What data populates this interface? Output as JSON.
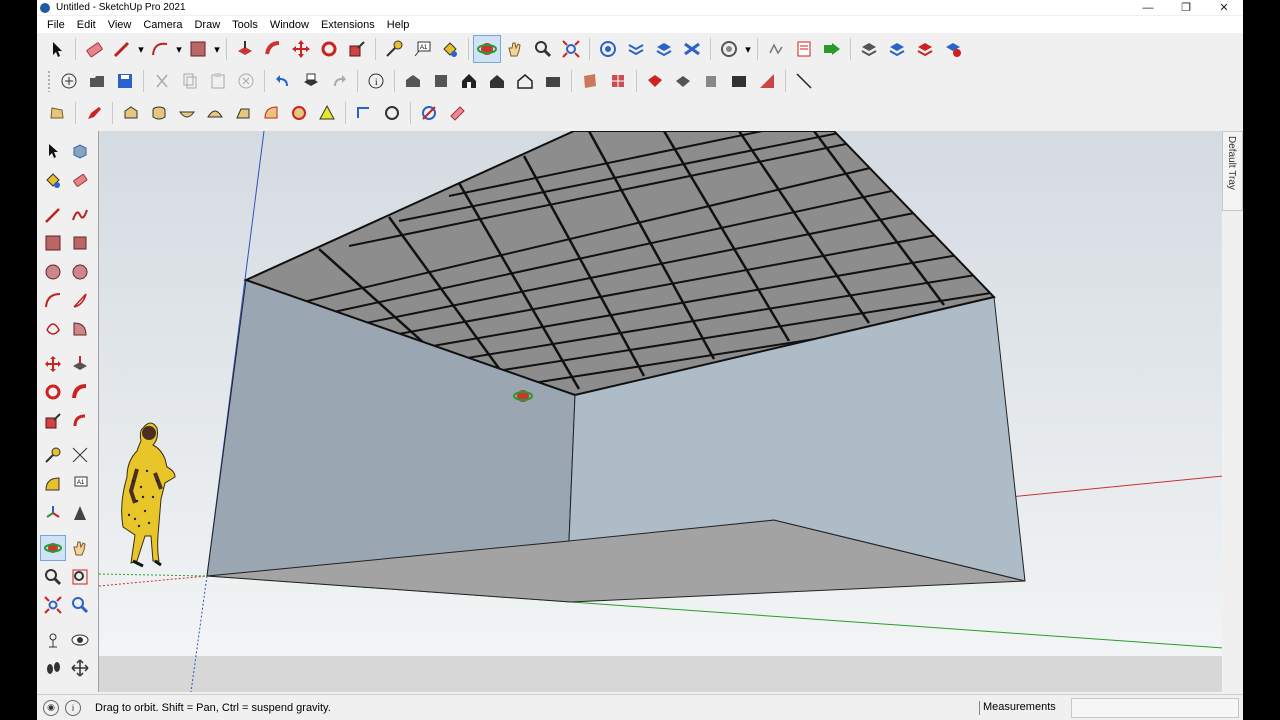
{
  "window": {
    "title": "Untitled - SketchUp Pro 2021",
    "controls": [
      "minimize",
      "restore",
      "close"
    ]
  },
  "menu": [
    "File",
    "Edit",
    "View",
    "Camera",
    "Draw",
    "Tools",
    "Window",
    "Extensions",
    "Help"
  ],
  "toolbar_row1": [
    "select-icon",
    "eraser-icon",
    "pencil-line-icon",
    "arc-icon",
    "rectangle-icon",
    "push-pull-icon",
    "follow-me-icon",
    "move-icon",
    "rotate-icon",
    "scale-icon",
    "tape-measure-icon",
    "text-icon",
    "paint-bucket-icon",
    "orbit-icon",
    "pan-icon",
    "zoom-icon",
    "zoom-extents-icon",
    "sandbox-icon",
    "solid-tools-icon",
    "components-icon",
    "styles-icon",
    "search-icon",
    "warehouse-icon",
    "layout-icon",
    "report-icon",
    "extension-icon"
  ],
  "toolbar_row2": [
    "new-icon",
    "open-icon",
    "save-icon",
    "cut-icon",
    "copy-icon",
    "paste-icon",
    "delete-icon",
    "undo-icon",
    "print-icon",
    "redo-icon",
    "model-info-icon",
    "iso-view-icon",
    "top-view-icon",
    "front-view-icon",
    "right-view-icon",
    "back-view-icon",
    "left-view-icon",
    "xray-icon",
    "wireframe-icon",
    "hidden-line-icon",
    "shaded-icon",
    "textured-icon",
    "monochrome-icon",
    "section-plane-icon"
  ],
  "toolbar_row3": [
    "warehouse-pin-icon",
    "eraser-red-icon",
    "cube-icon",
    "cylinder-icon",
    "bowl-icon",
    "dome-icon",
    "prism-icon",
    "arc-cube-icon",
    "torus-icon",
    "cone-icon",
    "extrude-icon",
    "sphere-icon",
    "gear-icon",
    "paint-icon"
  ],
  "palette_icons": [
    "select-icon",
    "component-icon",
    "paint-bucket-icon",
    "eraser-icon",
    "line-icon",
    "freehand-icon",
    "rectangle-icon",
    "rotated-rect-icon",
    "circle-icon",
    "polygon-icon",
    "arc-icon",
    "two-point-arc-icon",
    "three-point-arc-icon",
    "pie-icon",
    "move-icon",
    "push-pull-icon",
    "rotate-icon",
    "follow-me-icon",
    "scale-icon",
    "offset-icon",
    "tape-measure-icon",
    "dimension-icon",
    "protractor-icon",
    "text-icon",
    "axes-icon",
    "3d-text-icon",
    "orbit-icon",
    "pan-icon",
    "zoom-icon",
    "zoom-window-icon",
    "zoom-extents-icon",
    "previous-view-icon",
    "position-camera-icon",
    "look-around-icon",
    "walk-icon",
    "section-icon"
  ],
  "tray": {
    "label": "Default Tray"
  },
  "status": {
    "hint": "Drag to orbit. Shift = Pan, Ctrl = suspend gravity.",
    "measurements_label": "Measurements",
    "measurements_value": ""
  },
  "colors": {
    "active_tool_bg": "#cfe3f7",
    "axis_red": "#c83232",
    "axis_green": "#2c9b2c",
    "axis_blue": "#3050c8",
    "wall_left": "#9aa8b4",
    "wall_right": "#adbcc7",
    "ceiling": "#8e8e8e",
    "floor": "#9c9c9c",
    "sky": "#e8ecef",
    "ground": "#d7d7d7"
  }
}
